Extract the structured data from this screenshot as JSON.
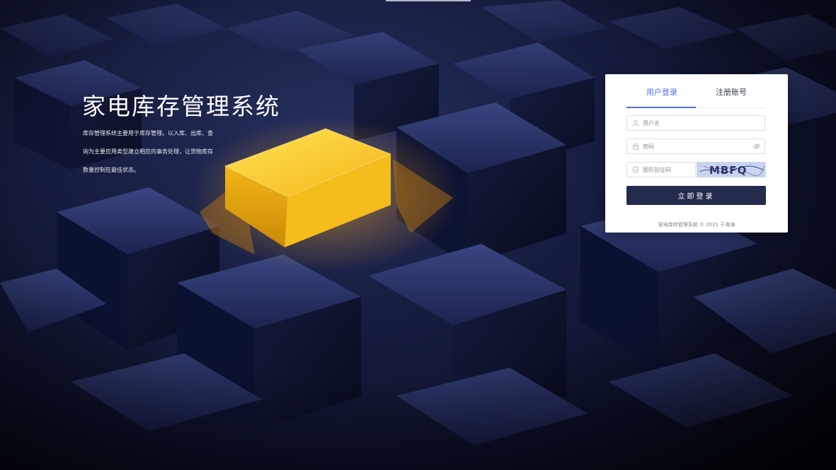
{
  "hero": {
    "title": "家电库存管理系统",
    "description": "库存管理系统主要用于库存管理。以入库、出库、查询为主要应用类型建立相应的事务处理，让货物库存数量控制在最佳状态。"
  },
  "login_card": {
    "tabs": [
      {
        "label": "用户登录",
        "active": true
      },
      {
        "label": "注册账号",
        "active": false
      }
    ],
    "username": {
      "placeholder": "用户名",
      "value": ""
    },
    "password": {
      "placeholder": "密码",
      "value": ""
    },
    "captcha": {
      "placeholder": "图形验证码",
      "value": "",
      "image_text": "MBFQ"
    },
    "submit_label": "立即登录",
    "footer": "家电库存管理系统 © 2021 于海涛"
  },
  "colors": {
    "accent": "#4e6ef2",
    "button_bg": "#242b4c",
    "background": "#161c3e",
    "highlight_cube": "#f5c022"
  }
}
